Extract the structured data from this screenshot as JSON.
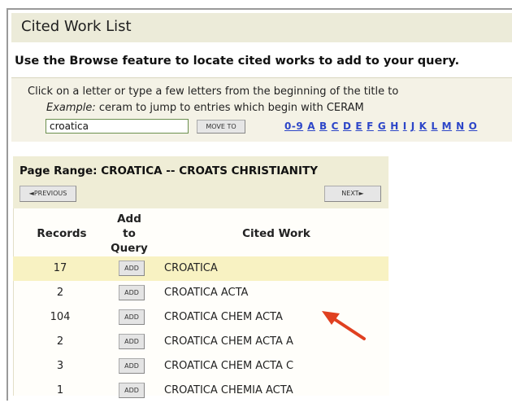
{
  "page": {
    "title": "Cited Work List",
    "instruction": "Use the Browse feature to locate cited works to add to your query."
  },
  "browse": {
    "line1": "Click on a letter or type a few letters from the beginning of the title to",
    "example_label": "Example:",
    "example_text": " ceram to jump to entries which begin with CERAM",
    "search_value": "croatica",
    "move_to_label": "MOVE TO",
    "letters": [
      "0-9",
      "A",
      "B",
      "C",
      "D",
      "E",
      "F",
      "G",
      "H",
      "I",
      "J",
      "K",
      "L",
      "M",
      "N",
      "O"
    ]
  },
  "results": {
    "page_range": "Page Range: CROATICA -- CROATS CHRISTIANITY",
    "previous_label": "◄PREVIOUS",
    "next_label": "NEXT►",
    "columns": {
      "records": "Records",
      "add": [
        "Add",
        "to",
        "Query"
      ],
      "work": "Cited Work"
    },
    "add_label": "ADD",
    "rows": [
      {
        "records": "17",
        "work": "CROATICA",
        "highlight": true
      },
      {
        "records": "2",
        "work": "CROATICA ACTA",
        "highlight": false
      },
      {
        "records": "104",
        "work": "CROATICA CHEM ACTA",
        "highlight": false
      },
      {
        "records": "2",
        "work": "CROATICA CHEM ACTA A",
        "highlight": false
      },
      {
        "records": "3",
        "work": "CROATICA CHEM ACTA C",
        "highlight": false
      },
      {
        "records": "1",
        "work": "CROATICA CHEMIA ACTA",
        "highlight": false
      }
    ]
  },
  "annotation": {
    "icon": "red-arrow-icon",
    "color": "#e04020"
  }
}
